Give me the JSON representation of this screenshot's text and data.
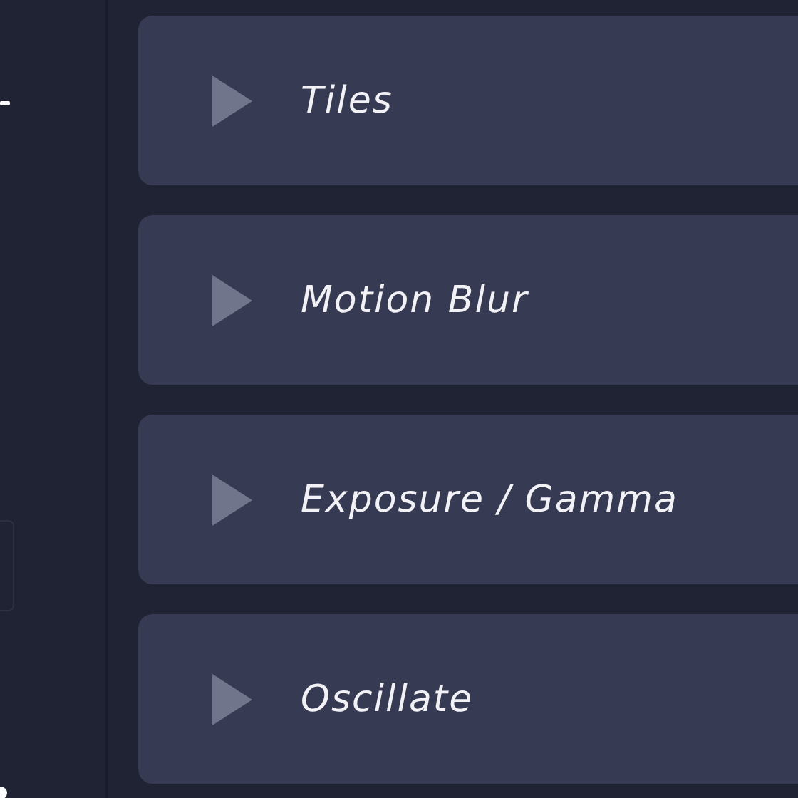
{
  "sections": [
    {
      "title": "Tiles",
      "expanded": false
    },
    {
      "title": "Motion Blur",
      "expanded": false
    },
    {
      "title": "Exposure / Gamma",
      "expanded": false
    },
    {
      "title": "Oscillate",
      "expanded": false
    }
  ]
}
